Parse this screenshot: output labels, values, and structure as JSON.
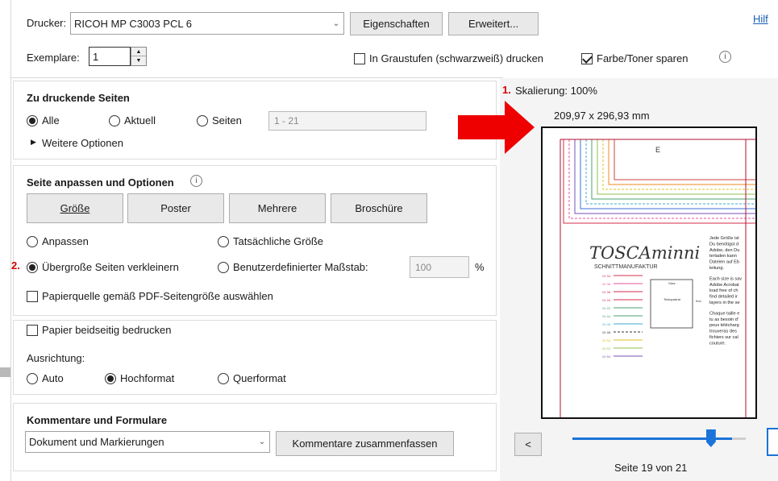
{
  "printer": {
    "label": "Drucker:",
    "value": "RICOH MP C3003 PCL 6",
    "properties": "Eigenschaften",
    "advanced": "Erweitert...",
    "help": "Hilf"
  },
  "copies": {
    "label": "Exemplare:",
    "value": "1"
  },
  "options": {
    "grayscale": "In Graustufen (schwarzweiß) drucken",
    "grayscale_checked": false,
    "save_toner": "Farbe/Toner sparen",
    "save_toner_checked": true
  },
  "pages": {
    "title": "Zu druckende Seiten",
    "all": "Alle",
    "current": "Aktuell",
    "pages": "Seiten",
    "range_value": "1 - 21",
    "more": "Weitere Optionen",
    "selected": "all"
  },
  "sizing": {
    "title": "Seite anpassen und Optionen",
    "buttons": [
      "Größe",
      "Poster",
      "Mehrere",
      "Broschüre"
    ],
    "fit": "Anpassen",
    "actual": "Tatsächliche Größe",
    "shrink": "Übergroße Seiten verkleinern",
    "custom": "Benutzerdefinierter Maßstab:",
    "custom_value": "100",
    "percent": "%",
    "paper_source": "Papierquelle gemäß PDF-Seitengröße auswählen",
    "selected": "shrink"
  },
  "duplex": {
    "label": "Papier beidseitig bedrucken"
  },
  "orientation": {
    "label": "Ausrichtung:",
    "auto": "Auto",
    "portrait": "Hochformat",
    "landscape": "Querformat",
    "selected": "portrait"
  },
  "comments": {
    "title": "Kommentare und Formulare",
    "value": "Dokument und Markierungen",
    "summarize": "Kommentare zusammenfassen"
  },
  "preview": {
    "scale": "Skalierung: 100%",
    "dimensions": "209,97 x 296,93 mm",
    "page_info": "Seite 19 von 21",
    "prev": "<",
    "slider_fraction": 0.92
  },
  "annotations": {
    "one": "1.",
    "two": "2."
  },
  "thumbnail": {
    "logo": "TOSCAminni",
    "tagline": "SCHNITTMANUFAKTUR",
    "label_e": "E",
    "box1": "Sara",
    "box2": "Testquadrat",
    "side_mark": "5cm",
    "sizes": [
      "Gr 34",
      "Gr 36",
      "Gr 38",
      "Gr 40",
      "Gr 42",
      "Gr 44",
      "Gr 46",
      "Gr 48",
      "Gr 50",
      "Gr 52",
      "Gr 54"
    ],
    "para1": [
      "Jede Größe ist",
      "Du benötigst d",
      "Adobe, den Du",
      "terladen kann",
      "Dateien auf Eb",
      "leitung."
    ],
    "para2": [
      "Each size is sav",
      "Adobe Acrobat",
      "load free of ch",
      "find detailed ir",
      "layers in the se"
    ],
    "para3": [
      "Chaque taille e",
      "tu as besoin d'",
      "peux télécharg",
      "trouveras des",
      "fichiers sur cal",
      "couture."
    ]
  },
  "colors": {
    "arrow": "#ee0000",
    "slider": "#1a73d9",
    "accent_red": "#d40000"
  }
}
